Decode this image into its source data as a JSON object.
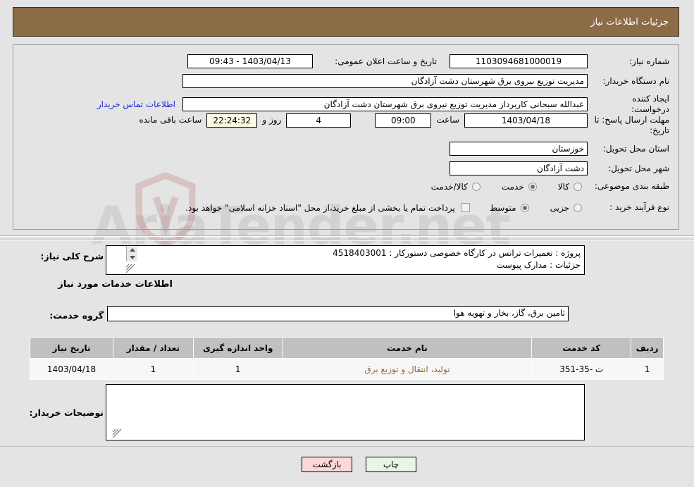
{
  "header": {
    "title": "جزئیات اطلاعات نیاز",
    "bg": "#8c6b47"
  },
  "watermark": {
    "text": "AriaTender.net"
  },
  "form": {
    "need_number_label": "شماره نیاز:",
    "need_number_value": "1103094681000019",
    "announce_label": "تاریخ و ساعت اعلان عمومی:",
    "announce_value": "1403/04/13 - 09:43",
    "buyer_org_label": "نام دستگاه خریدار:",
    "buyer_org_value": "مدیریت توزیع نیروی برق شهرستان دشت آزادگان",
    "creator_label": "ایجاد کننده درخواست:",
    "creator_value": "عبدالله سبحانی کاربرداز مدیریت توزیع نیروی برق شهرستان دشت آزادگان",
    "contact_link": "اطلاعات تماس خریدار",
    "deadline_label": "مهلت ارسال پاسخ: تا تاریخ:",
    "deadline_date": "1403/04/18",
    "hour_label": "ساعت",
    "deadline_time": "09:00",
    "days_value": "4",
    "days_word": "روز و",
    "countdown_value": "22:24:32",
    "countdown_word": "ساعت باقی مانده",
    "province_label": "استان محل تحویل:",
    "province_value": "خوزستان",
    "city_label": "شهر محل تحویل:",
    "city_value": "دشت آزادگان",
    "category_label": "طبقه بندی موضوعی:",
    "category_options": [
      {
        "label": "کالا",
        "selected": false
      },
      {
        "label": "خدمت",
        "selected": true
      },
      {
        "label": "کالا/خدمت",
        "selected": false
      }
    ],
    "process_label": "نوع فرآیند خرید :",
    "process_options": [
      {
        "label": "جزیی",
        "selected": false
      },
      {
        "label": "متوسط",
        "selected": true
      }
    ],
    "treasury_checkbox_label": "پرداخت تمام یا بخشی از مبلغ خرید،از محل \"اسناد خزانه اسلامی\" خواهد بود.",
    "treasury_checked": false
  },
  "description": {
    "label": "شرح کلی نیاز:",
    "line1": "پروژه : تعمیرات ترانس در کارگاه خصوصی  دستورکار : 4518403001",
    "line2": "جزئیات : مدارک پیوست"
  },
  "services": {
    "section_title": "اطلاعات خدمات مورد نیاز",
    "group_label": "گروه خدمت:",
    "group_value": "تامین برق، گاز، بخار و تهویه هوا",
    "columns": [
      "ردیف",
      "کد خدمت",
      "نام خدمت",
      "واحد اندازه گیری",
      "تعداد / مقدار",
      "تاریخ نیاز"
    ],
    "rows": [
      {
        "index": "1",
        "code": "ت -35-351",
        "name": "تولید، انتقال و توزیع برق",
        "unit": "1",
        "quantity": "1",
        "need_date": "1403/04/18"
      }
    ]
  },
  "buyer_notes": {
    "label": "توضیحات خریدار:",
    "value": ""
  },
  "footer": {
    "print_label": "چاپ",
    "back_label": "بازگشت"
  }
}
